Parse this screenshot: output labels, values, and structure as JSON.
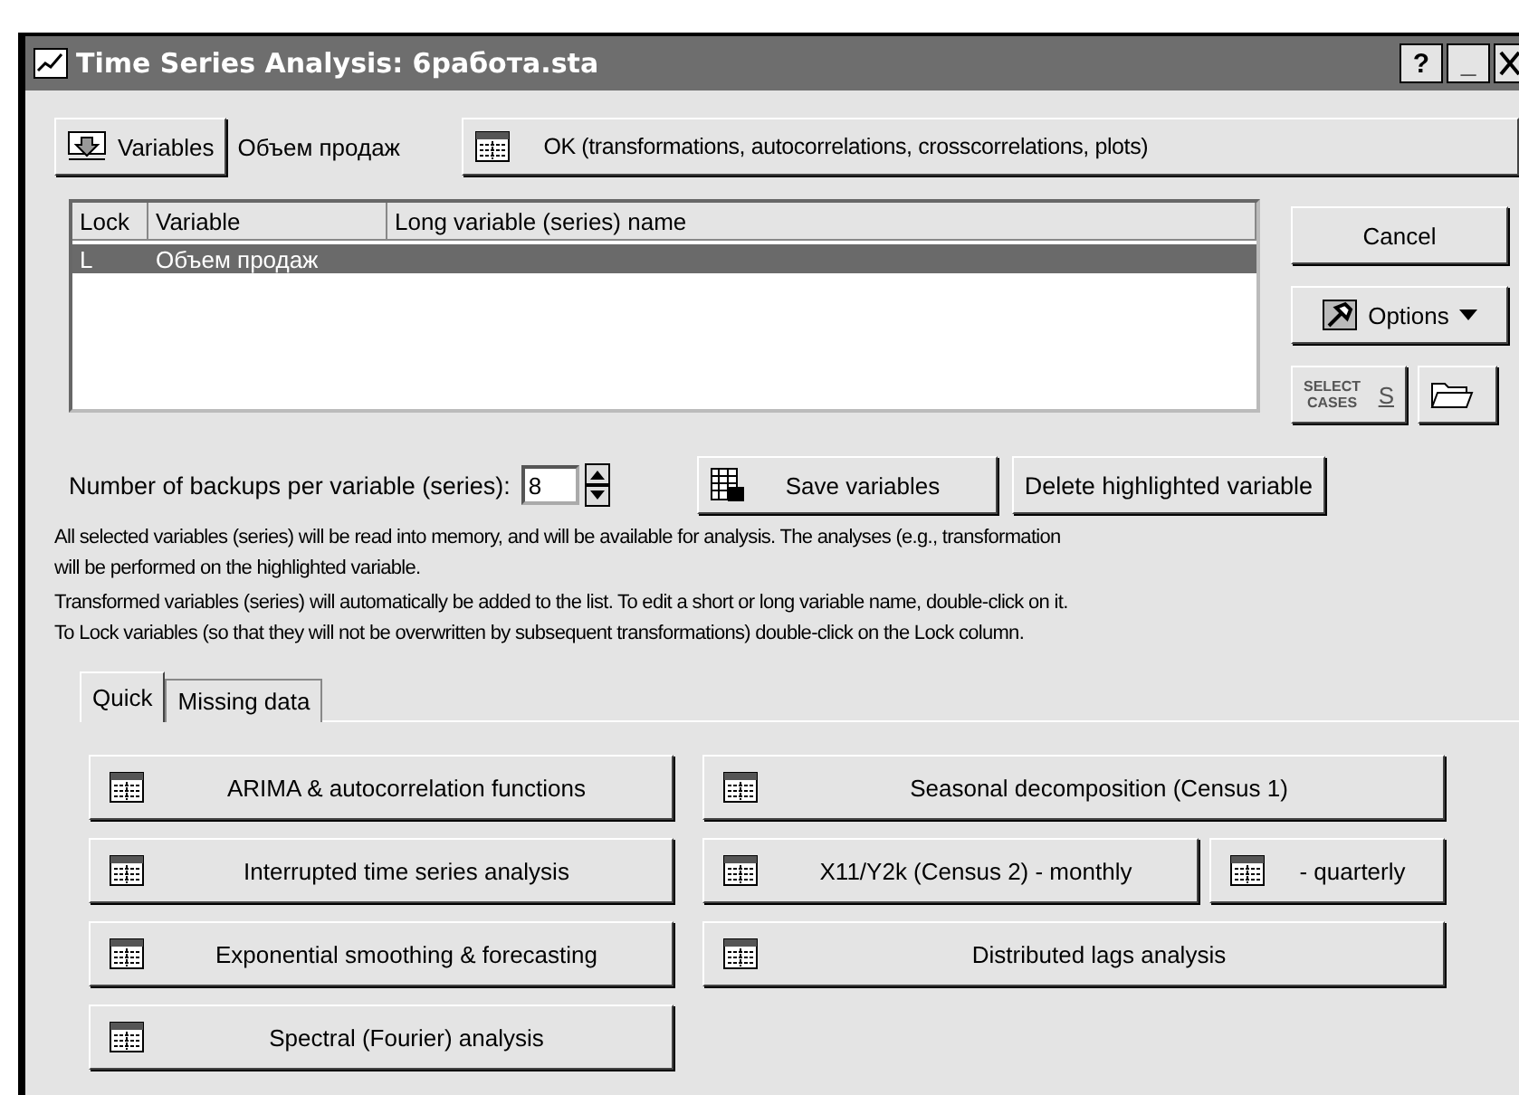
{
  "window": {
    "title": "Time Series Analysis: 6работа.sta",
    "title_buttons": [
      "?",
      "_"
    ]
  },
  "toolbar": {
    "variables_button": "Variables",
    "current_variable": "Объем продаж",
    "ok_button": "OK (transformations, autocorrelations, crosscorrelations, plots)"
  },
  "variable_list": {
    "columns": [
      "Lock",
      "Variable",
      "Long variable (series) name"
    ],
    "rows": [
      {
        "lock": "L",
        "variable": "Объем продаж",
        "selected": true
      }
    ]
  },
  "side_buttons": {
    "cancel": "Cancel",
    "options": "Options",
    "select_cases": [
      "SELECT",
      "CASES"
    ],
    "select_cases_key": "S"
  },
  "backups": {
    "label": "Number of backups per variable (series):",
    "value": "8"
  },
  "save_button": "Save variables",
  "delete_button": "Delete highlighted variable",
  "notes": [
    "All selected variables (series) will be read into memory, and will be available for analysis. The analyses (e.g., transformation",
    "will be performed on the highlighted variable.",
    "Transformed variables (series) will automatically be added to the list. To edit a short or long variable name, double-click on it.",
    "To Lock variables (so that they will not be overwritten by subsequent transformations) double-click on the Lock column."
  ],
  "tabs": [
    {
      "label": "Quick",
      "selected": true
    },
    {
      "label": "Missing data",
      "selected": false
    }
  ],
  "left_buttons": [
    "ARIMA & autocorrelation functions",
    "Interrupted time series analysis",
    "Exponential smoothing & forecasting",
    "Spectral (Fourier) analysis"
  ],
  "right_rows": [
    [
      "Seasonal decomposition (Census 1)"
    ],
    [
      "X11/Y2k (Census 2) - monthly",
      "- quarterly"
    ],
    [
      "Distributed lags analysis"
    ]
  ]
}
